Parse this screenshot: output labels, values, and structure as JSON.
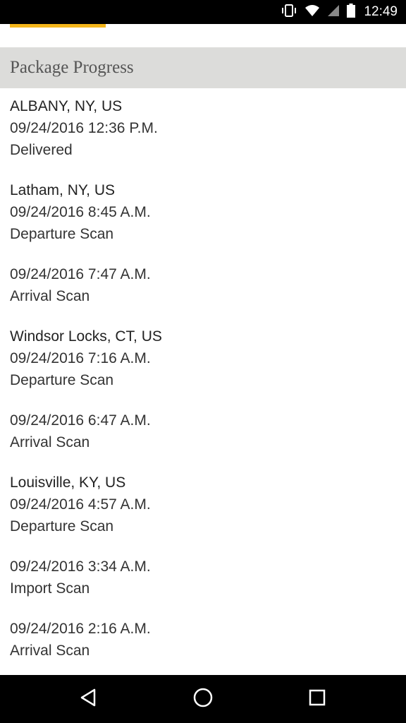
{
  "status_bar": {
    "time": "12:49",
    "icons": [
      "vibrate-icon",
      "wifi-icon",
      "cell-signal-icon",
      "battery-icon"
    ]
  },
  "header": {
    "title": "Package Progress"
  },
  "accent_color": "#f5b61a",
  "events": [
    {
      "location": "ALBANY, NY, US",
      "datetime": "09/24/2016 12:36 P.M.",
      "status": "Delivered"
    },
    {
      "location": "Latham, NY, US",
      "datetime": "09/24/2016 8:45 A.M.",
      "status": "Departure Scan"
    },
    {
      "location": "",
      "datetime": "09/24/2016 7:47 A.M.",
      "status": "Arrival Scan"
    },
    {
      "location": "Windsor Locks, CT, US",
      "datetime": "09/24/2016 7:16 A.M.",
      "status": "Departure Scan"
    },
    {
      "location": "",
      "datetime": "09/24/2016 6:47 A.M.",
      "status": "Arrival Scan"
    },
    {
      "location": "Louisville, KY, US",
      "datetime": "09/24/2016 4:57 A.M.",
      "status": "Departure Scan"
    },
    {
      "location": "",
      "datetime": "09/24/2016 3:34 A.M.",
      "status": "Import Scan"
    },
    {
      "location": "",
      "datetime": "09/24/2016 2:16 A.M.",
      "status": "Arrival Scan"
    }
  ],
  "nav_bar": {
    "buttons": [
      "back-icon",
      "home-icon",
      "recents-icon"
    ]
  }
}
